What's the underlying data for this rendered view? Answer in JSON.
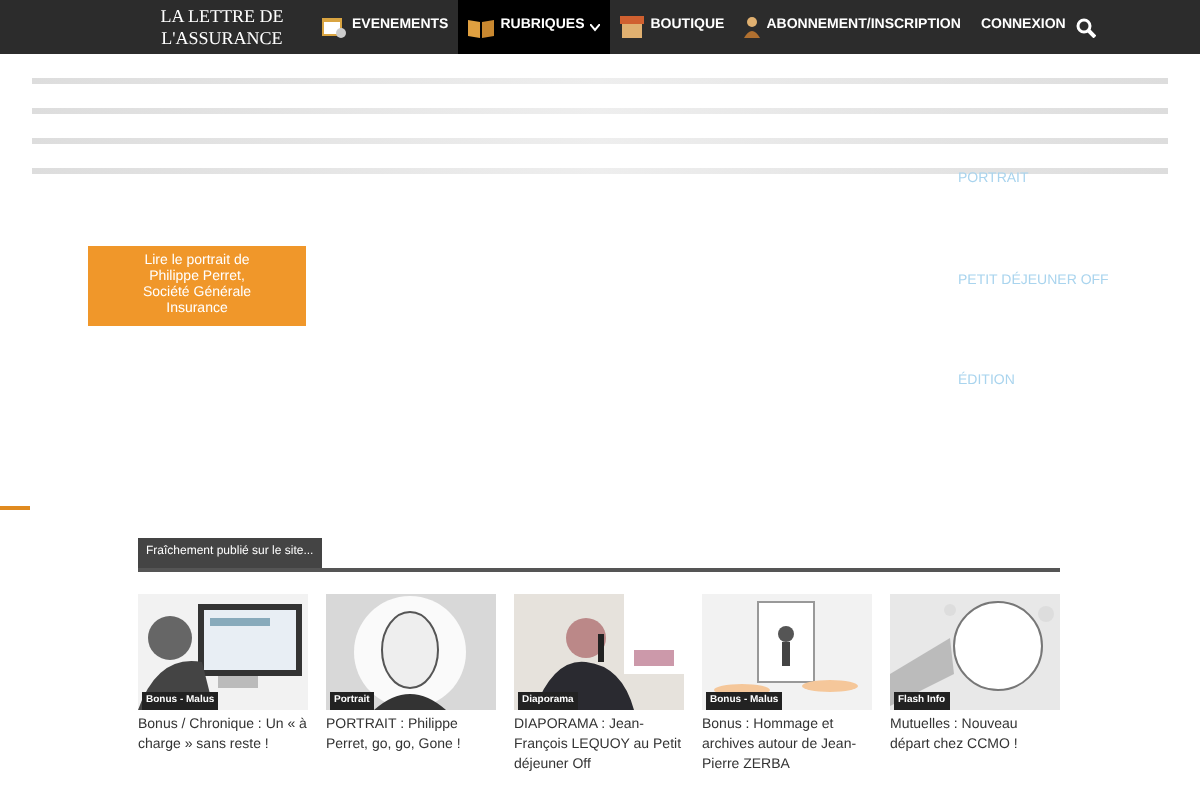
{
  "logo": "LA LETTRE DE L'ASSURANCE",
  "nav": [
    {
      "label": "EVENEMENTS",
      "kind": "calendar",
      "selected": false,
      "dropdown": false
    },
    {
      "label": "RUBRIQUES",
      "kind": "book",
      "selected": true,
      "dropdown": true
    },
    {
      "label": "BOUTIQUE",
      "kind": "shop",
      "selected": false,
      "dropdown": false
    },
    {
      "label": "ABONNEMENT/INSCRIPTION",
      "kind": "person",
      "selected": false,
      "dropdown": false
    },
    {
      "label": "CONNEXION",
      "kind": "none",
      "selected": false,
      "dropdown": false
    }
  ],
  "promo_button": "Lire le portrait de Philippe Perret, Société Générale Insurance",
  "side_links": [
    "PORTRAIT",
    "PETIT DÉJEUNER OFF",
    "ÉDITION"
  ],
  "section_title": "Fraîchement publié sur le site...",
  "posts": [
    {
      "tag": "Bonus - Malus",
      "title": "Bonus / Chronique : Un « à charge » sans reste !",
      "kind": "computer"
    },
    {
      "tag": "Portrait",
      "title": "PORTRAIT : Philippe Perret, go, go, Gone !",
      "kind": "figure"
    },
    {
      "tag": "Diaporama",
      "title": "DIAPORAMA : Jean-François LEQUOY au Petit déjeuner Off",
      "kind": "speaker"
    },
    {
      "tag": "Bonus - Malus",
      "title": "Bonus : Hommage et archives autour de Jean-Pierre ZERBA",
      "kind": "sketch"
    },
    {
      "tag": "Flash Info",
      "title": "Mutuelles : Nouveau départ chez CCMO !",
      "kind": "bubble"
    }
  ]
}
